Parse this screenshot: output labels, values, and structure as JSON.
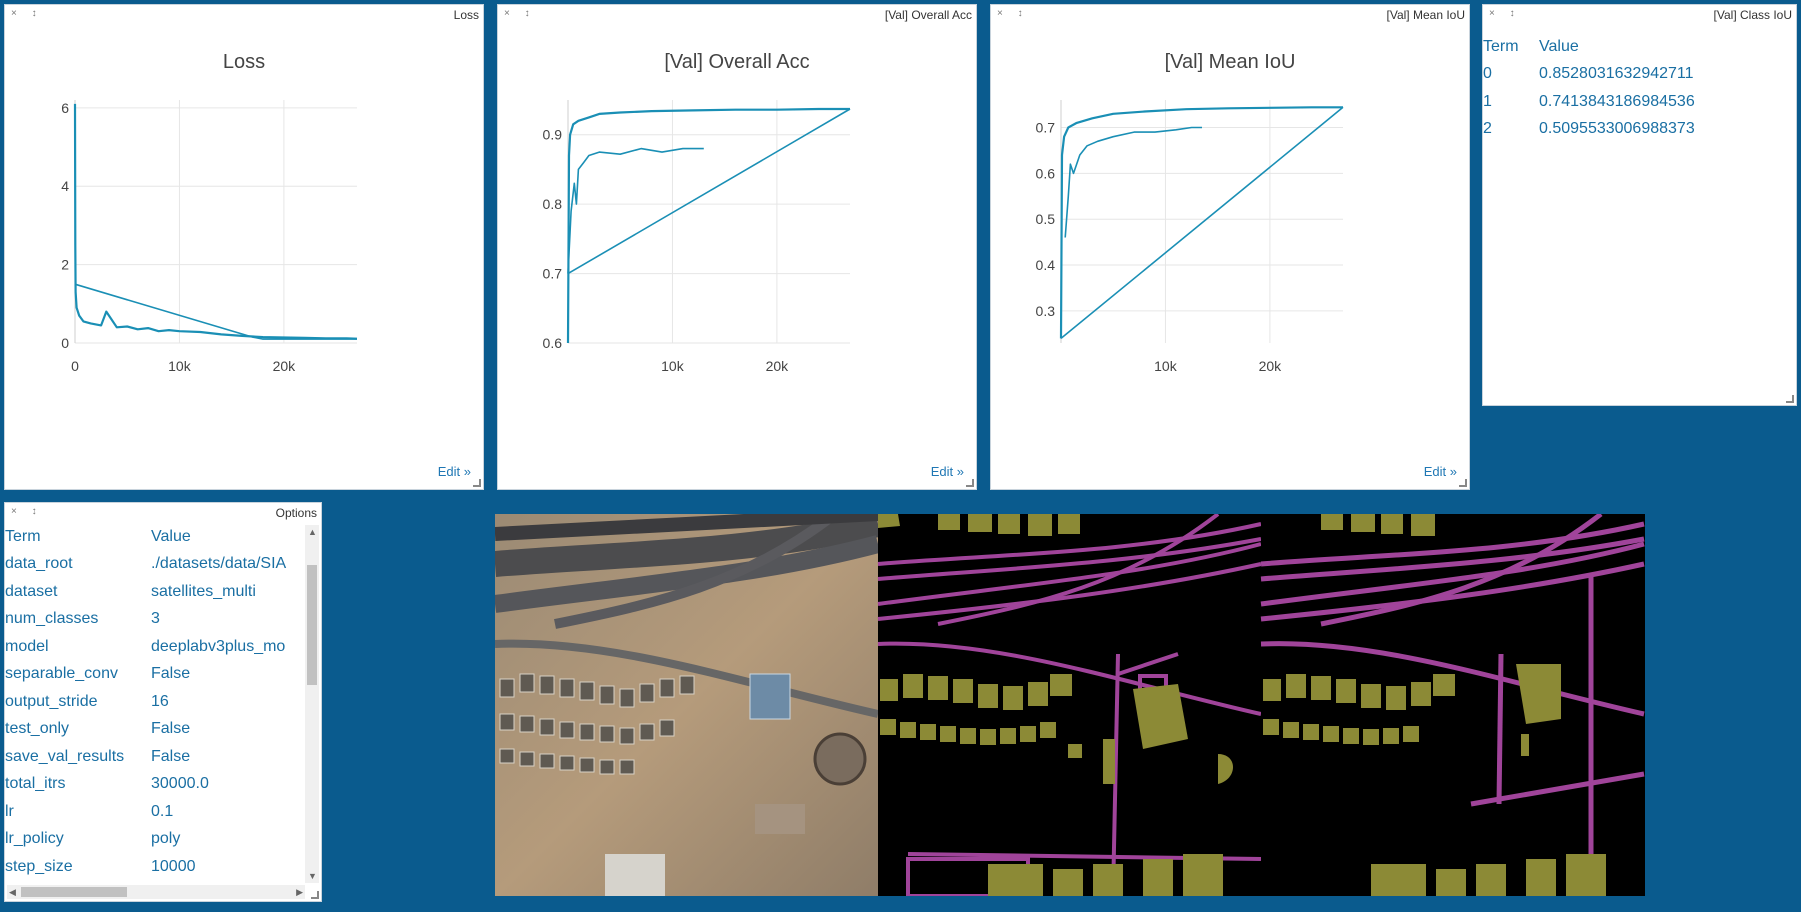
{
  "panes": {
    "loss": {
      "window_title": "Loss",
      "title": "Loss",
      "edit": "Edit »"
    },
    "acc": {
      "window_title": "[Val] Overall Acc",
      "title": "[Val] Overall Acc",
      "edit": "Edit »"
    },
    "miou": {
      "window_title": "[Val] Mean IoU",
      "title": "[Val] Mean IoU",
      "edit": "Edit »"
    },
    "class_iou": {
      "window_title": "[Val] Class IoU",
      "headers": [
        "Term",
        "Value"
      ],
      "rows": [
        [
          "0",
          "0.8528031632942711"
        ],
        [
          "1",
          "0.7413843186984536"
        ],
        [
          "2",
          "0.5095533006988373"
        ]
      ]
    },
    "options": {
      "window_title": "Options",
      "headers": [
        "Term",
        "Value"
      ],
      "rows": [
        [
          "data_root",
          "./datasets/data/SIA"
        ],
        [
          "dataset",
          "satellites_multi"
        ],
        [
          "num_classes",
          "3"
        ],
        [
          "model",
          "deeplabv3plus_mo"
        ],
        [
          "separable_conv",
          "False"
        ],
        [
          "output_stride",
          "16"
        ],
        [
          "test_only",
          "False"
        ],
        [
          "save_val_results",
          "False"
        ],
        [
          "total_itrs",
          "30000.0"
        ],
        [
          "lr",
          "0.1"
        ],
        [
          "lr_policy",
          "poly"
        ],
        [
          "step_size",
          "10000"
        ]
      ]
    }
  },
  "colors": {
    "background": "#0a5b8e",
    "series": "#1a8fb5",
    "link": "#1a6fa3",
    "building": "#8c8a36",
    "road": "#a0449a"
  },
  "chart_data": [
    {
      "type": "line",
      "title": "Loss",
      "xlim": [
        0,
        27000
      ],
      "ylim": [
        0,
        6.2
      ],
      "xticks": [
        {
          "v": 0,
          "label": "0"
        },
        {
          "v": 10000,
          "label": "10k"
        },
        {
          "v": 20000,
          "label": "20k"
        }
      ],
      "yticks": [
        {
          "v": 0,
          "label": "0"
        },
        {
          "v": 2,
          "label": "2"
        },
        {
          "v": 4,
          "label": "4"
        },
        {
          "v": 6,
          "label": "6"
        }
      ],
      "series": [
        {
          "x": [
            0,
            30,
            60,
            150,
            400,
            800,
            1500,
            2500,
            3000,
            4000,
            5000,
            6000,
            7000,
            8000,
            9000,
            10000,
            12000,
            14000,
            16000,
            18000,
            20000,
            22000,
            24000,
            26000,
            27000
          ],
          "y": [
            6.1,
            2.5,
            1.3,
            0.9,
            0.7,
            0.55,
            0.5,
            0.45,
            0.8,
            0.4,
            0.42,
            0.35,
            0.38,
            0.3,
            0.33,
            0.3,
            0.28,
            0.22,
            0.18,
            0.15,
            0.14,
            0.13,
            0.12,
            0.12,
            0.11
          ]
        },
        {
          "x": [
            0,
            17000,
            18000,
            27000
          ],
          "y": [
            1.5,
            0.15,
            0.1,
            0.1
          ]
        }
      ]
    },
    {
      "type": "line",
      "title": "[Val] Overall Acc",
      "xlim": [
        0,
        27000
      ],
      "ylim": [
        0.6,
        0.95
      ],
      "xticks": [
        {
          "v": 10000,
          "label": "10k"
        },
        {
          "v": 20000,
          "label": "20k"
        }
      ],
      "yticks": [
        {
          "v": 0.6,
          "label": "0.6"
        },
        {
          "v": 0.7,
          "label": "0.7"
        },
        {
          "v": 0.8,
          "label": "0.8"
        },
        {
          "v": 0.9,
          "label": "0.9"
        }
      ],
      "series": [
        {
          "x": [
            0,
            100,
            200,
            500,
            1000,
            2000,
            3000,
            5000,
            8000,
            12000,
            16000,
            20000,
            24000,
            27000
          ],
          "y": [
            0.6,
            0.87,
            0.9,
            0.915,
            0.92,
            0.925,
            0.93,
            0.932,
            0.934,
            0.935,
            0.936,
            0.936,
            0.937,
            0.937
          ]
        },
        {
          "x": [
            0,
            300,
            600,
            800,
            1000,
            1500,
            2000,
            3000,
            5000,
            7000,
            9000,
            11000,
            13000
          ],
          "y": [
            0.7,
            0.79,
            0.83,
            0.8,
            0.85,
            0.86,
            0.87,
            0.875,
            0.872,
            0.88,
            0.875,
            0.88,
            0.88
          ]
        },
        {
          "x": [
            0,
            27000
          ],
          "y": [
            0.7,
            0.937
          ]
        }
      ]
    },
    {
      "type": "line",
      "title": "[Val] Mean IoU",
      "xlim": [
        0,
        27000
      ],
      "ylim": [
        0.23,
        0.76
      ],
      "xticks": [
        {
          "v": 10000,
          "label": "10k"
        },
        {
          "v": 20000,
          "label": "20k"
        }
      ],
      "yticks": [
        {
          "v": 0.3,
          "label": "0.3"
        },
        {
          "v": 0.4,
          "label": "0.4"
        },
        {
          "v": 0.5,
          "label": "0.5"
        },
        {
          "v": 0.6,
          "label": "0.6"
        },
        {
          "v": 0.7,
          "label": "0.7"
        }
      ],
      "series": [
        {
          "x": [
            0,
            100,
            300,
            700,
            1500,
            3000,
            5000,
            8000,
            12000,
            16000,
            20000,
            24000,
            27000
          ],
          "y": [
            0.24,
            0.64,
            0.68,
            0.7,
            0.71,
            0.72,
            0.73,
            0.735,
            0.74,
            0.742,
            0.743,
            0.744,
            0.744
          ]
        },
        {
          "x": [
            400,
            700,
            900,
            1200,
            1800,
            2500,
            3500,
            5000,
            7000,
            9000,
            11000,
            12500,
            13500
          ],
          "y": [
            0.46,
            0.55,
            0.62,
            0.6,
            0.64,
            0.66,
            0.67,
            0.68,
            0.69,
            0.69,
            0.695,
            0.7,
            0.7
          ]
        },
        {
          "x": [
            0,
            27000
          ],
          "y": [
            0.24,
            0.744
          ]
        }
      ]
    }
  ]
}
